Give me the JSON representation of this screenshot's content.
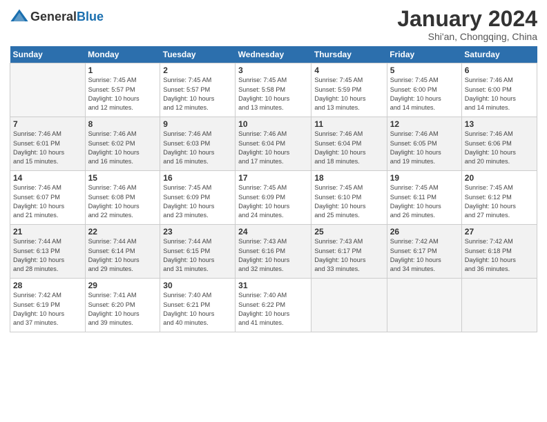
{
  "header": {
    "logo_general": "General",
    "logo_blue": "Blue",
    "month_title": "January 2024",
    "location": "Shi'an, Chongqing, China"
  },
  "days_of_week": [
    "Sunday",
    "Monday",
    "Tuesday",
    "Wednesday",
    "Thursday",
    "Friday",
    "Saturday"
  ],
  "weeks": [
    [
      {
        "num": "",
        "info": ""
      },
      {
        "num": "1",
        "info": "Sunrise: 7:45 AM\nSunset: 5:57 PM\nDaylight: 10 hours\nand 12 minutes."
      },
      {
        "num": "2",
        "info": "Sunrise: 7:45 AM\nSunset: 5:57 PM\nDaylight: 10 hours\nand 12 minutes."
      },
      {
        "num": "3",
        "info": "Sunrise: 7:45 AM\nSunset: 5:58 PM\nDaylight: 10 hours\nand 13 minutes."
      },
      {
        "num": "4",
        "info": "Sunrise: 7:45 AM\nSunset: 5:59 PM\nDaylight: 10 hours\nand 13 minutes."
      },
      {
        "num": "5",
        "info": "Sunrise: 7:45 AM\nSunset: 6:00 PM\nDaylight: 10 hours\nand 14 minutes."
      },
      {
        "num": "6",
        "info": "Sunrise: 7:46 AM\nSunset: 6:00 PM\nDaylight: 10 hours\nand 14 minutes."
      }
    ],
    [
      {
        "num": "7",
        "info": "Sunrise: 7:46 AM\nSunset: 6:01 PM\nDaylight: 10 hours\nand 15 minutes."
      },
      {
        "num": "8",
        "info": "Sunrise: 7:46 AM\nSunset: 6:02 PM\nDaylight: 10 hours\nand 16 minutes."
      },
      {
        "num": "9",
        "info": "Sunrise: 7:46 AM\nSunset: 6:03 PM\nDaylight: 10 hours\nand 16 minutes."
      },
      {
        "num": "10",
        "info": "Sunrise: 7:46 AM\nSunset: 6:04 PM\nDaylight: 10 hours\nand 17 minutes."
      },
      {
        "num": "11",
        "info": "Sunrise: 7:46 AM\nSunset: 6:04 PM\nDaylight: 10 hours\nand 18 minutes."
      },
      {
        "num": "12",
        "info": "Sunrise: 7:46 AM\nSunset: 6:05 PM\nDaylight: 10 hours\nand 19 minutes."
      },
      {
        "num": "13",
        "info": "Sunrise: 7:46 AM\nSunset: 6:06 PM\nDaylight: 10 hours\nand 20 minutes."
      }
    ],
    [
      {
        "num": "14",
        "info": "Sunrise: 7:46 AM\nSunset: 6:07 PM\nDaylight: 10 hours\nand 21 minutes."
      },
      {
        "num": "15",
        "info": "Sunrise: 7:46 AM\nSunset: 6:08 PM\nDaylight: 10 hours\nand 22 minutes."
      },
      {
        "num": "16",
        "info": "Sunrise: 7:45 AM\nSunset: 6:09 PM\nDaylight: 10 hours\nand 23 minutes."
      },
      {
        "num": "17",
        "info": "Sunrise: 7:45 AM\nSunset: 6:09 PM\nDaylight: 10 hours\nand 24 minutes."
      },
      {
        "num": "18",
        "info": "Sunrise: 7:45 AM\nSunset: 6:10 PM\nDaylight: 10 hours\nand 25 minutes."
      },
      {
        "num": "19",
        "info": "Sunrise: 7:45 AM\nSunset: 6:11 PM\nDaylight: 10 hours\nand 26 minutes."
      },
      {
        "num": "20",
        "info": "Sunrise: 7:45 AM\nSunset: 6:12 PM\nDaylight: 10 hours\nand 27 minutes."
      }
    ],
    [
      {
        "num": "21",
        "info": "Sunrise: 7:44 AM\nSunset: 6:13 PM\nDaylight: 10 hours\nand 28 minutes."
      },
      {
        "num": "22",
        "info": "Sunrise: 7:44 AM\nSunset: 6:14 PM\nDaylight: 10 hours\nand 29 minutes."
      },
      {
        "num": "23",
        "info": "Sunrise: 7:44 AM\nSunset: 6:15 PM\nDaylight: 10 hours\nand 31 minutes."
      },
      {
        "num": "24",
        "info": "Sunrise: 7:43 AM\nSunset: 6:16 PM\nDaylight: 10 hours\nand 32 minutes."
      },
      {
        "num": "25",
        "info": "Sunrise: 7:43 AM\nSunset: 6:17 PM\nDaylight: 10 hours\nand 33 minutes."
      },
      {
        "num": "26",
        "info": "Sunrise: 7:42 AM\nSunset: 6:17 PM\nDaylight: 10 hours\nand 34 minutes."
      },
      {
        "num": "27",
        "info": "Sunrise: 7:42 AM\nSunset: 6:18 PM\nDaylight: 10 hours\nand 36 minutes."
      }
    ],
    [
      {
        "num": "28",
        "info": "Sunrise: 7:42 AM\nSunset: 6:19 PM\nDaylight: 10 hours\nand 37 minutes."
      },
      {
        "num": "29",
        "info": "Sunrise: 7:41 AM\nSunset: 6:20 PM\nDaylight: 10 hours\nand 39 minutes."
      },
      {
        "num": "30",
        "info": "Sunrise: 7:40 AM\nSunset: 6:21 PM\nDaylight: 10 hours\nand 40 minutes."
      },
      {
        "num": "31",
        "info": "Sunrise: 7:40 AM\nSunset: 6:22 PM\nDaylight: 10 hours\nand 41 minutes."
      },
      {
        "num": "",
        "info": ""
      },
      {
        "num": "",
        "info": ""
      },
      {
        "num": "",
        "info": ""
      }
    ]
  ]
}
